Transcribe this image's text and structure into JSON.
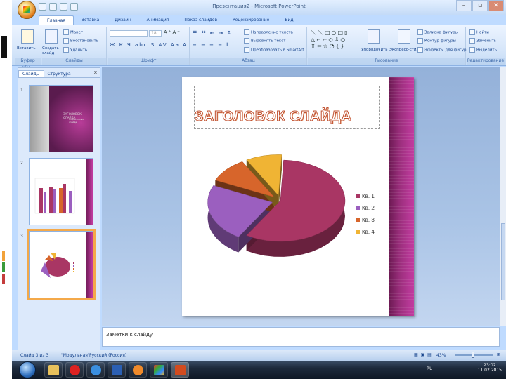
{
  "window": {
    "title": "Презентация2 - Microsoft PowerPoint",
    "buttons": {
      "minimize": "–",
      "maximize": "▫",
      "close": "✕"
    }
  },
  "ribbon": {
    "tabs": [
      "Главная",
      "Вставка",
      "Дизайн",
      "Анимация",
      "Показ слайдов",
      "Рецензирование",
      "Вид"
    ],
    "active_tab": "Главная",
    "groups": {
      "clipboard": {
        "label": "Буфер обм...",
        "paste": "Вставить"
      },
      "slides": {
        "label": "Слайды",
        "layout": "Макет",
        "reset": "Восстановить",
        "create": "Создать слайд",
        "delete": "Удалить"
      },
      "font": {
        "label": "Шрифт",
        "font_size": "18"
      },
      "paragraph": {
        "label": "Абзац",
        "text_direction": "Направление текста",
        "align_text": "Выровнять текст",
        "smartart": "Преобразовать в SmartArt"
      },
      "drawing": {
        "label": "Рисование",
        "arrange": "Упорядочить",
        "quick_styles": "Экспресс-стили",
        "shape_fill": "Заливка фигуры",
        "shape_outline": "Контур фигуры",
        "shape_effects": "Эффекты для фигур"
      },
      "editing": {
        "label": "Редактирование",
        "find": "Найти",
        "replace": "Заменить",
        "select": "Выделить"
      }
    }
  },
  "slides_pane": {
    "tabs": [
      "Слайды",
      "Структура"
    ],
    "active_tab": "Слайды",
    "close": "x",
    "slides": [
      {
        "number": "1",
        "title": "ЗАГОЛОВОК СЛАЙДА",
        "subtitle": "Подзаголовок слайда"
      },
      {
        "number": "2"
      },
      {
        "number": "3",
        "selected": true
      }
    ]
  },
  "slide": {
    "title": "ЗАГОЛОВОК СЛАЙДА",
    "accent_color": "#8f2a72"
  },
  "chart_data": {
    "type": "pie",
    "title": "",
    "categories": [
      "Кв. 1",
      "Кв. 2",
      "Кв. 3",
      "Кв. 4"
    ],
    "values": [
      58,
      23,
      10,
      9
    ],
    "colors": [
      "#a93664",
      "#9b5fbf",
      "#d7652b",
      "#f0b434"
    ],
    "legend_position": "right",
    "exploded": true,
    "three_d": true
  },
  "notes": {
    "placeholder": "Заметки к слайду"
  },
  "status_bar": {
    "slide_info": "Слайд 3 из 3",
    "theme": "\"Модульная\"",
    "language": "Русский (Россия)",
    "zoom": "43%"
  },
  "taskbar": {
    "language": "RU",
    "time": "23:02",
    "date": "11.02.2015",
    "apps": [
      "explorer",
      "opera",
      "internet-explorer",
      "word",
      "media-player",
      "windows",
      "powerpoint"
    ]
  }
}
